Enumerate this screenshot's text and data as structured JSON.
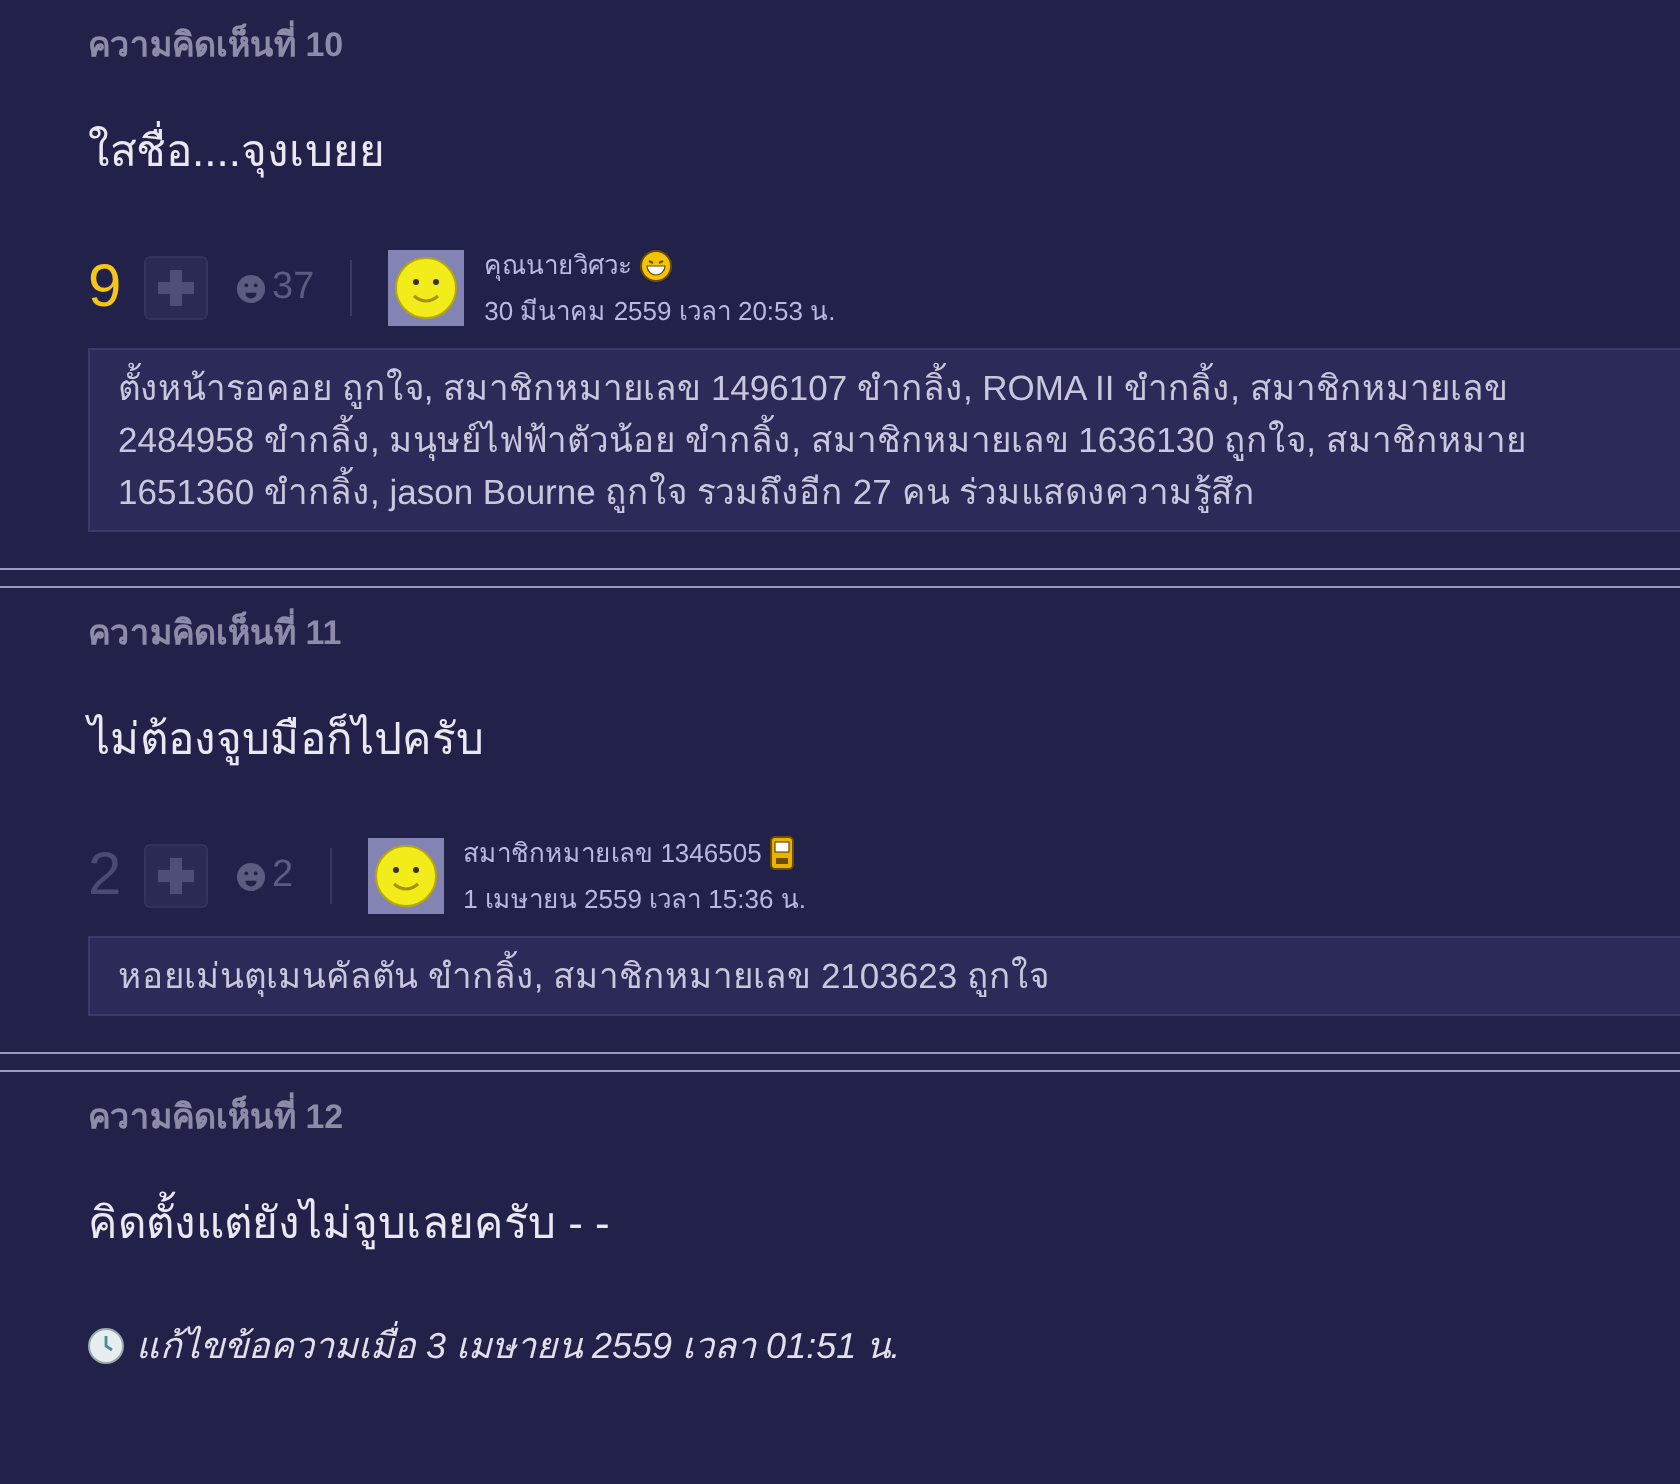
{
  "comments": [
    {
      "label": "ความคิดเห็นที่ 10",
      "body": "ใสชื่อ....จุงเบยย",
      "score": "9",
      "score_hot": true,
      "emotion_count": "37",
      "author": "คุณนายวิศวะ",
      "badge": {
        "kind": "emoji"
      },
      "date": "30 มีนาคม 2559 เวลา 20:53 น.",
      "reaction_lines": [
        "ตั้งหน้ารอคอย ถูกใจ, สมาชิกหมายเลข 1496107 ขำกลิ้ง, ROMA II ขำกลิ้ง, สมาชิกหมายเลข",
        "2484958 ขำกลิ้ง, มนุษย์ไฟฟ้าตัวน้อย ขำกลิ้ง, สมาชิกหมายเลข 1636130 ถูกใจ, สมาชิกหมาย",
        "1651360 ขำกลิ้ง, jason Bourne ถูกใจ รวมถึงอีก 27 คน ร่วมแสดงความรู้สึก"
      ]
    },
    {
      "label": "ความคิดเห็นที่ 11",
      "body": "ไม่ต้องจูบมือก็ไปครับ",
      "score": "2",
      "score_hot": false,
      "emotion_count": "2",
      "author": "สมาชิกหมายเลข 1346505",
      "badge": {
        "kind": "phone"
      },
      "date": "1 เมษายน 2559 เวลา 15:36 น.",
      "reaction_lines": [
        "หอยเม่นตุเมนคัลตัน ขำกลิ้ง, สมาชิกหมายเลข 2103623 ถูกใจ"
      ]
    },
    {
      "label": "ความคิดเห็นที่ 12",
      "body": "คิดตั้งแต่ยังไม่จูบเลยครับ - -",
      "edited": "แก้ไขข้อความเมื่อ 3 เมษายน 2559 เวลา 01:51 น."
    }
  ]
}
